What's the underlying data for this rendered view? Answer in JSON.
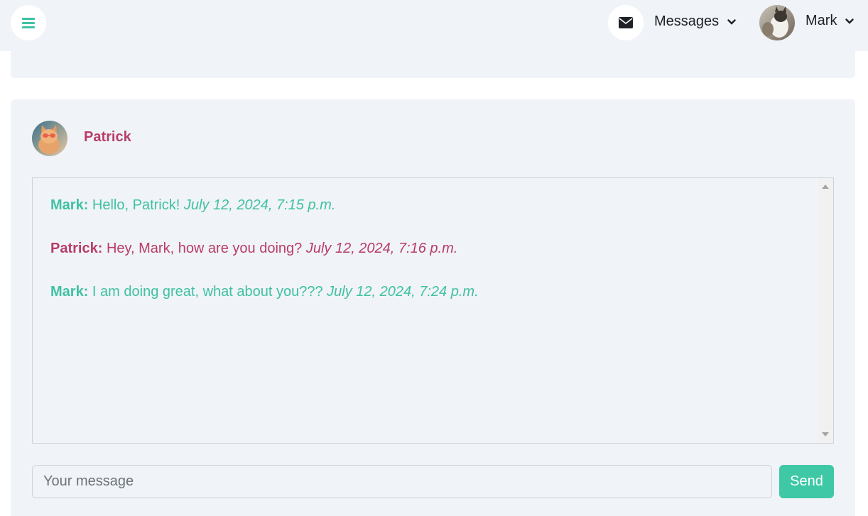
{
  "topbar": {
    "menu_icon": "hamburger-icon",
    "mail_icon": "envelope-icon",
    "messages_label": "Messages",
    "user_name": "Mark"
  },
  "chat": {
    "contact_name": "Patrick",
    "messages": [
      {
        "author": "Mark:",
        "text": "Hello, Patrick!",
        "time": "July 12, 2024, 7:15 p.m."
      },
      {
        "author": "Patrick:",
        "text": "Hey, Mark, how are you doing?",
        "time": "July 12, 2024, 7:16 p.m."
      },
      {
        "author": "Mark:",
        "text": "I am doing great, what about you???",
        "time": "July 12, 2024, 7:24 p.m."
      }
    ]
  },
  "composer": {
    "placeholder": "Your message",
    "value": "",
    "send_label": "Send"
  },
  "colors": {
    "accent": "#3fc1a3",
    "contact": "#b83d68",
    "panel_bg": "#f0f3f7"
  }
}
